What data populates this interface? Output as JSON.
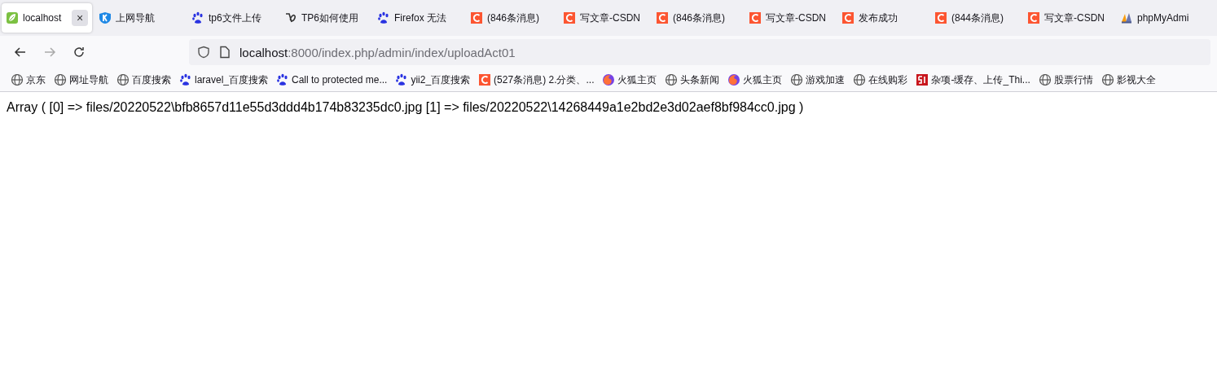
{
  "tabs": [
    {
      "title": "localhost",
      "kind": "leaf",
      "selected": true,
      "close": "×"
    },
    {
      "title": "上网导航",
      "kind": "shield",
      "selected": false
    },
    {
      "title": "tp6文件上传",
      "kind": "paw",
      "selected": false
    },
    {
      "title": "TP6如何使用",
      "kind": "swirl",
      "selected": false
    },
    {
      "title": "Firefox 无法",
      "kind": "paw",
      "selected": false
    },
    {
      "title": "(846条消息)",
      "kind": "c",
      "selected": false
    },
    {
      "title": "写文章-CSDN",
      "kind": "c",
      "selected": false
    },
    {
      "title": "(846条消息)",
      "kind": "c",
      "selected": false
    },
    {
      "title": "写文章-CSDN",
      "kind": "c",
      "selected": false
    },
    {
      "title": "发布成功",
      "kind": "c",
      "selected": false
    },
    {
      "title": "(844条消息)",
      "kind": "c",
      "selected": false
    },
    {
      "title": "写文章-CSDN",
      "kind": "c",
      "selected": false
    },
    {
      "title": "phpMyAdmi",
      "kind": "pma",
      "selected": false
    }
  ],
  "address_bar": {
    "host": "localhost",
    "path": ":8000/index.php/admin/index/uploadAct01"
  },
  "bookmarks": [
    {
      "label": "京东",
      "kind": "globe"
    },
    {
      "label": "网址导航",
      "kind": "globe"
    },
    {
      "label": "百度搜索",
      "kind": "globe"
    },
    {
      "label": "laravel_百度搜索",
      "kind": "paw"
    },
    {
      "label": "Call to protected me...",
      "kind": "paw"
    },
    {
      "label": "yii2_百度搜索",
      "kind": "paw"
    },
    {
      "label": "(527条消息) 2.分类、...",
      "kind": "c"
    },
    {
      "label": "火狐主页",
      "kind": "fox"
    },
    {
      "label": "头条新闻",
      "kind": "globe"
    },
    {
      "label": "火狐主页",
      "kind": "fox"
    },
    {
      "label": "游戏加速",
      "kind": "globe"
    },
    {
      "label": "在线购彩",
      "kind": "globe"
    },
    {
      "label": "杂项-缓存、上传_Thi...",
      "kind": "num"
    },
    {
      "label": "股票行情",
      "kind": "globe"
    },
    {
      "label": "影视大全",
      "kind": "globe"
    }
  ],
  "page_text": "Array ( [0] => files/20220522\\bfb8657d11e55d3ddd4b174b83235dc0.jpg [1] => files/20220522\\14268449a1e2bd2e3d02aef8bf984cc0.jpg )"
}
